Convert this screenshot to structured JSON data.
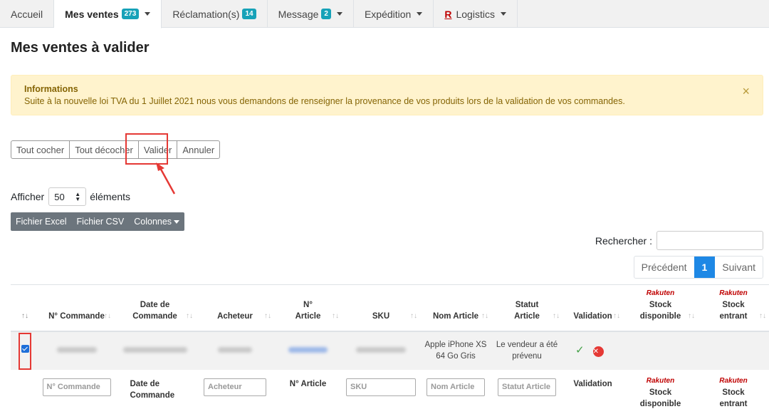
{
  "tabs": [
    {
      "label": "Accueil"
    },
    {
      "label": "Mes ventes",
      "badge": "273"
    },
    {
      "label": "Réclamation(s)",
      "badge": "14"
    },
    {
      "label": "Message",
      "badge": "2"
    },
    {
      "label": "Expédition"
    },
    {
      "label": "Logistics",
      "logo": "R"
    }
  ],
  "page_title": "Mes ventes à valider",
  "alert": {
    "title": "Informations",
    "text": "Suite à la nouvelle loi TVA du 1 Juillet 2021 nous vous demandons de renseigner la provenance de vos produits lors de la validation de vos commandes.",
    "close": "×"
  },
  "actions": {
    "check_all": "Tout cocher",
    "uncheck_all": "Tout décocher",
    "validate": "Valider",
    "cancel": "Annuler"
  },
  "show": {
    "before": "Afficher",
    "value": "50",
    "after": "éléments"
  },
  "export": {
    "excel": "Fichier Excel",
    "csv": "Fichier CSV",
    "columns": "Colonnes"
  },
  "search": {
    "label": "Rechercher :"
  },
  "pager": {
    "prev": "Précédent",
    "current": "1",
    "next": "Suivant"
  },
  "table": {
    "headers": {
      "order_no": "N° Commande",
      "order_date": "Date de Commande",
      "buyer": "Acheteur",
      "article_no": "N° Article",
      "sku": "SKU",
      "article_name": "Nom Article",
      "status": "Statut Article",
      "validation": "Validation",
      "rakuten": "Rakuten",
      "stock_available": "Stock disponible",
      "stock_incoming": "Stock entrant"
    },
    "row": {
      "article_name": "Apple iPhone XS 64 Go Gris",
      "status": "Le vendeur a été prévenu",
      "checked": true
    },
    "filters": {
      "order_no": "N° Commande",
      "order_date": "Date de Commande",
      "buyer": "Acheteur",
      "article_no": "N° Article",
      "sku": "SKU",
      "article_name": "Nom Article",
      "status": "Statut Article",
      "validation": "Validation",
      "stock_available": "Stock disponible",
      "stock_incoming": "Stock entrant"
    }
  },
  "colors": {
    "accent": "#1e88e5",
    "badge": "#17a2b8",
    "alert_bg": "#fff3cd",
    "highlight": "#e53935",
    "rakuten": "#bf0000"
  }
}
